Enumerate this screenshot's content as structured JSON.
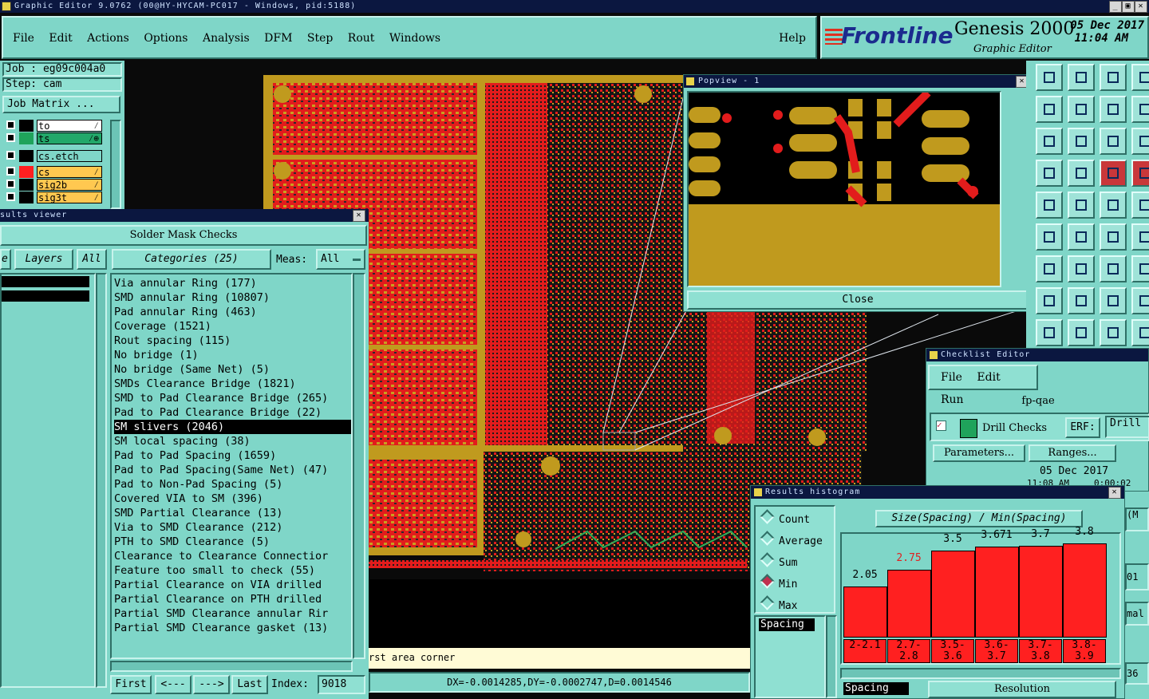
{
  "window_title": "Graphic Editor 9.0762 (00@HY-HYCAM-PC017 - Windows, pid:5188)",
  "window_controls": {
    "minimize": "_",
    "maximize": "▣",
    "close": "✕"
  },
  "menu": [
    "File",
    "Edit",
    "Actions",
    "Options",
    "Analysis",
    "DFM",
    "Step",
    "Rout",
    "Windows"
  ],
  "help_label": "Help",
  "brand": {
    "logo": "Frontline",
    "product": "Genesis 2000",
    "subtitle": "Graphic Editor",
    "date": "05 Dec 2017",
    "time": "11:04 AM"
  },
  "job": {
    "job": "Job : eg09c004a0",
    "step": "Step: cam",
    "matrix_button": "Job Matrix ..."
  },
  "layers": [
    {
      "name": "to",
      "color": "#ffffff",
      "swatch": "#000000",
      "mark": "⁄"
    },
    {
      "name": "ts",
      "color": "#22a86a",
      "swatch": "#1fa35b",
      "mark": "⁄⊕"
    },
    {
      "name": "cs.etch",
      "color": "#7fd6c8",
      "swatch": "#000000",
      "mark": ""
    },
    {
      "name": "cs",
      "color": "#ffc850",
      "swatch": "#ff2020",
      "mark": "⁄"
    },
    {
      "name": "sig2b",
      "color": "#ffc850",
      "swatch": "#000000",
      "mark": "⁄"
    },
    {
      "name": "sig3t",
      "color": "#ffc850",
      "swatch": "#000000",
      "mark": "⁄"
    }
  ],
  "results_viewer": {
    "title": "sults viewer",
    "heading": "Solder Mask Checks",
    "tab_e": "e",
    "layers_tab": "Layers",
    "all_tab": "All",
    "categories_tab": "Categories (25)",
    "meas_label": "Meas:",
    "meas_value": "All",
    "categories": [
      "Via annular Ring (177)",
      "SMD annular Ring (10807)",
      "Pad annular Ring (463)",
      "Coverage (1521)",
      "Rout spacing (115)",
      "No bridge (1)",
      "No bridge (Same Net) (5)",
      "SMDs Clearance Bridge (1821)",
      "SMD to Pad Clearance Bridge (265)",
      "Pad to Pad Clearance Bridge (22)",
      "SM slivers (2046)",
      "SM local spacing (38)",
      "Pad to Pad Spacing (1659)",
      "Pad to Pad Spacing(Same Net) (47)",
      "Pad to Non-Pad Spacing (5)",
      "Covered VIA to SM (396)",
      "SMD Partial Clearance (13)",
      "Via to SMD Clearance (212)",
      "PTH to SMD Clearance (5)",
      "Clearance to Clearance Connectior",
      "Feature too small to check (55)",
      "Partial Clearance on VIA drilled",
      "Partial Clearance on PTH drilled",
      "Partial SMD Clearance annular Rir",
      "Partial SMD Clearance gasket (13)"
    ],
    "selected_index": 10,
    "nav": {
      "first": "First",
      "prev": "<---",
      "next": "--->",
      "last": "Last",
      "index_label": "Index:",
      "index_value": "9018"
    }
  },
  "status": {
    "prompt": "rst area corner",
    "coords": "DX=-0.0014285,DY=-0.0002747,D=0.0014546"
  },
  "popview": {
    "title": "Popview - 1",
    "close_label": "Close"
  },
  "checklist": {
    "title": "Checklist Editor",
    "menu": [
      "File",
      "Edit",
      "Run"
    ],
    "name": "fp-qae",
    "item": "Drill Checks",
    "erf_label": "ERF:",
    "erf_value": "Drill",
    "params_button": "Parameters...",
    "ranges_button": "Ranges...",
    "date": "05 Dec 2017",
    "time_partial": "11:08 AM",
    "elapsed_partial": "0:00:02",
    "right_clip": [
      "(M",
      "01",
      "mal",
      "36"
    ]
  },
  "histogram": {
    "title": "Results histogram",
    "options": [
      "Count",
      "Average",
      "Sum",
      "Min",
      "Max"
    ],
    "selected_option": "Min",
    "header": "Size(Spacing) / Min(Spacing)",
    "measure_label": "Spacing",
    "bottom_left": "Spacing",
    "resolution_label": "Resolution",
    "bars": [
      {
        "value": "2.05",
        "range": "2-2.1",
        "v": 2.05,
        "highlight": false
      },
      {
        "value": "2.75",
        "range": "2.7-2.8",
        "v": 2.75,
        "highlight": true
      },
      {
        "value": "3.5",
        "range": "3.5-3.6",
        "v": 3.5,
        "highlight": false
      },
      {
        "value": "3.671",
        "range": "3.6-3.7",
        "v": 3.671,
        "highlight": false
      },
      {
        "value": "3.7",
        "range": "3.7-3.8",
        "v": 3.7,
        "highlight": false
      },
      {
        "value": "3.8",
        "range": "3.8-3.9",
        "v": 3.8,
        "highlight": false
      }
    ]
  }
}
